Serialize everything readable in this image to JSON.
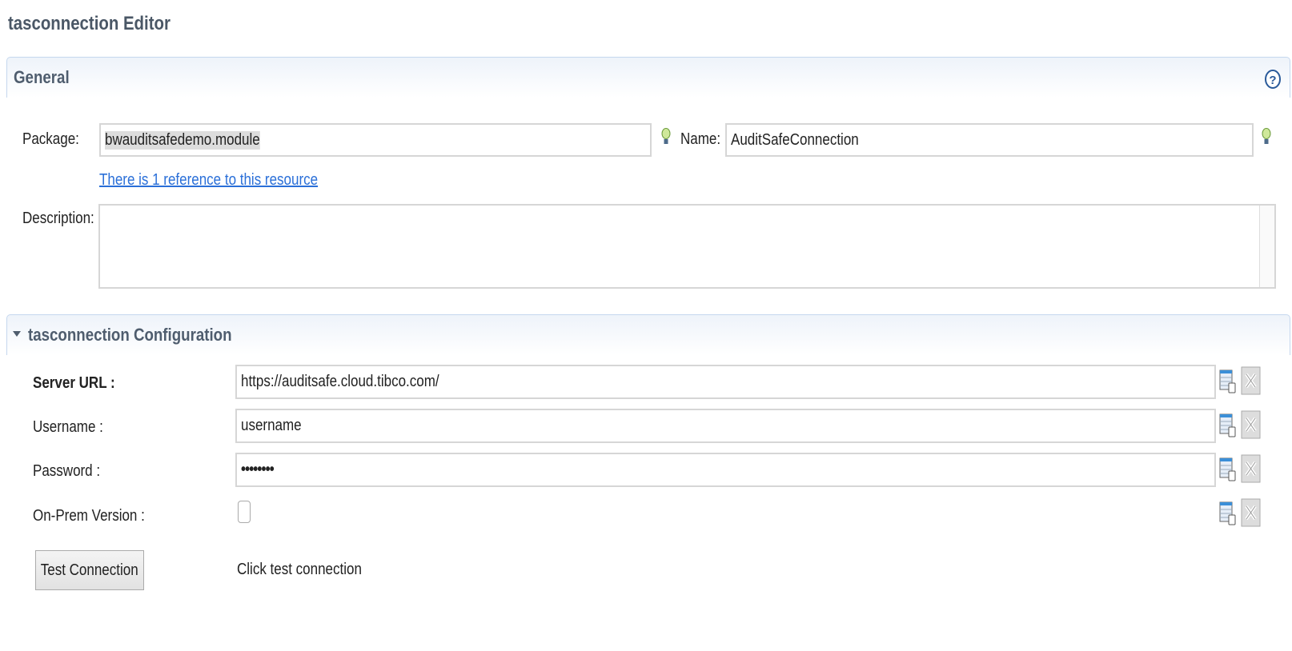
{
  "title": "tasconnection Editor",
  "general": {
    "header": "General",
    "package_label": "Package:",
    "package_value": "bwauditsafedemo.module",
    "name_label": "Name:",
    "name_value": "AuditSafeConnection",
    "reference_link": "There is 1 reference to this resource",
    "description_label": "Description:",
    "description_value": ""
  },
  "config": {
    "header": "tasconnection Configuration",
    "server_url_label": "Server URL :",
    "server_url_value": "https://auditsafe.cloud.tibco.com/",
    "username_label": "Username :",
    "username_value": "username",
    "password_label": "Password :",
    "password_value": "••••••••",
    "onprem_label": "On-Prem Version :",
    "onprem_checked": false,
    "test_button": "Test Connection",
    "status_text": "Click test connection"
  }
}
